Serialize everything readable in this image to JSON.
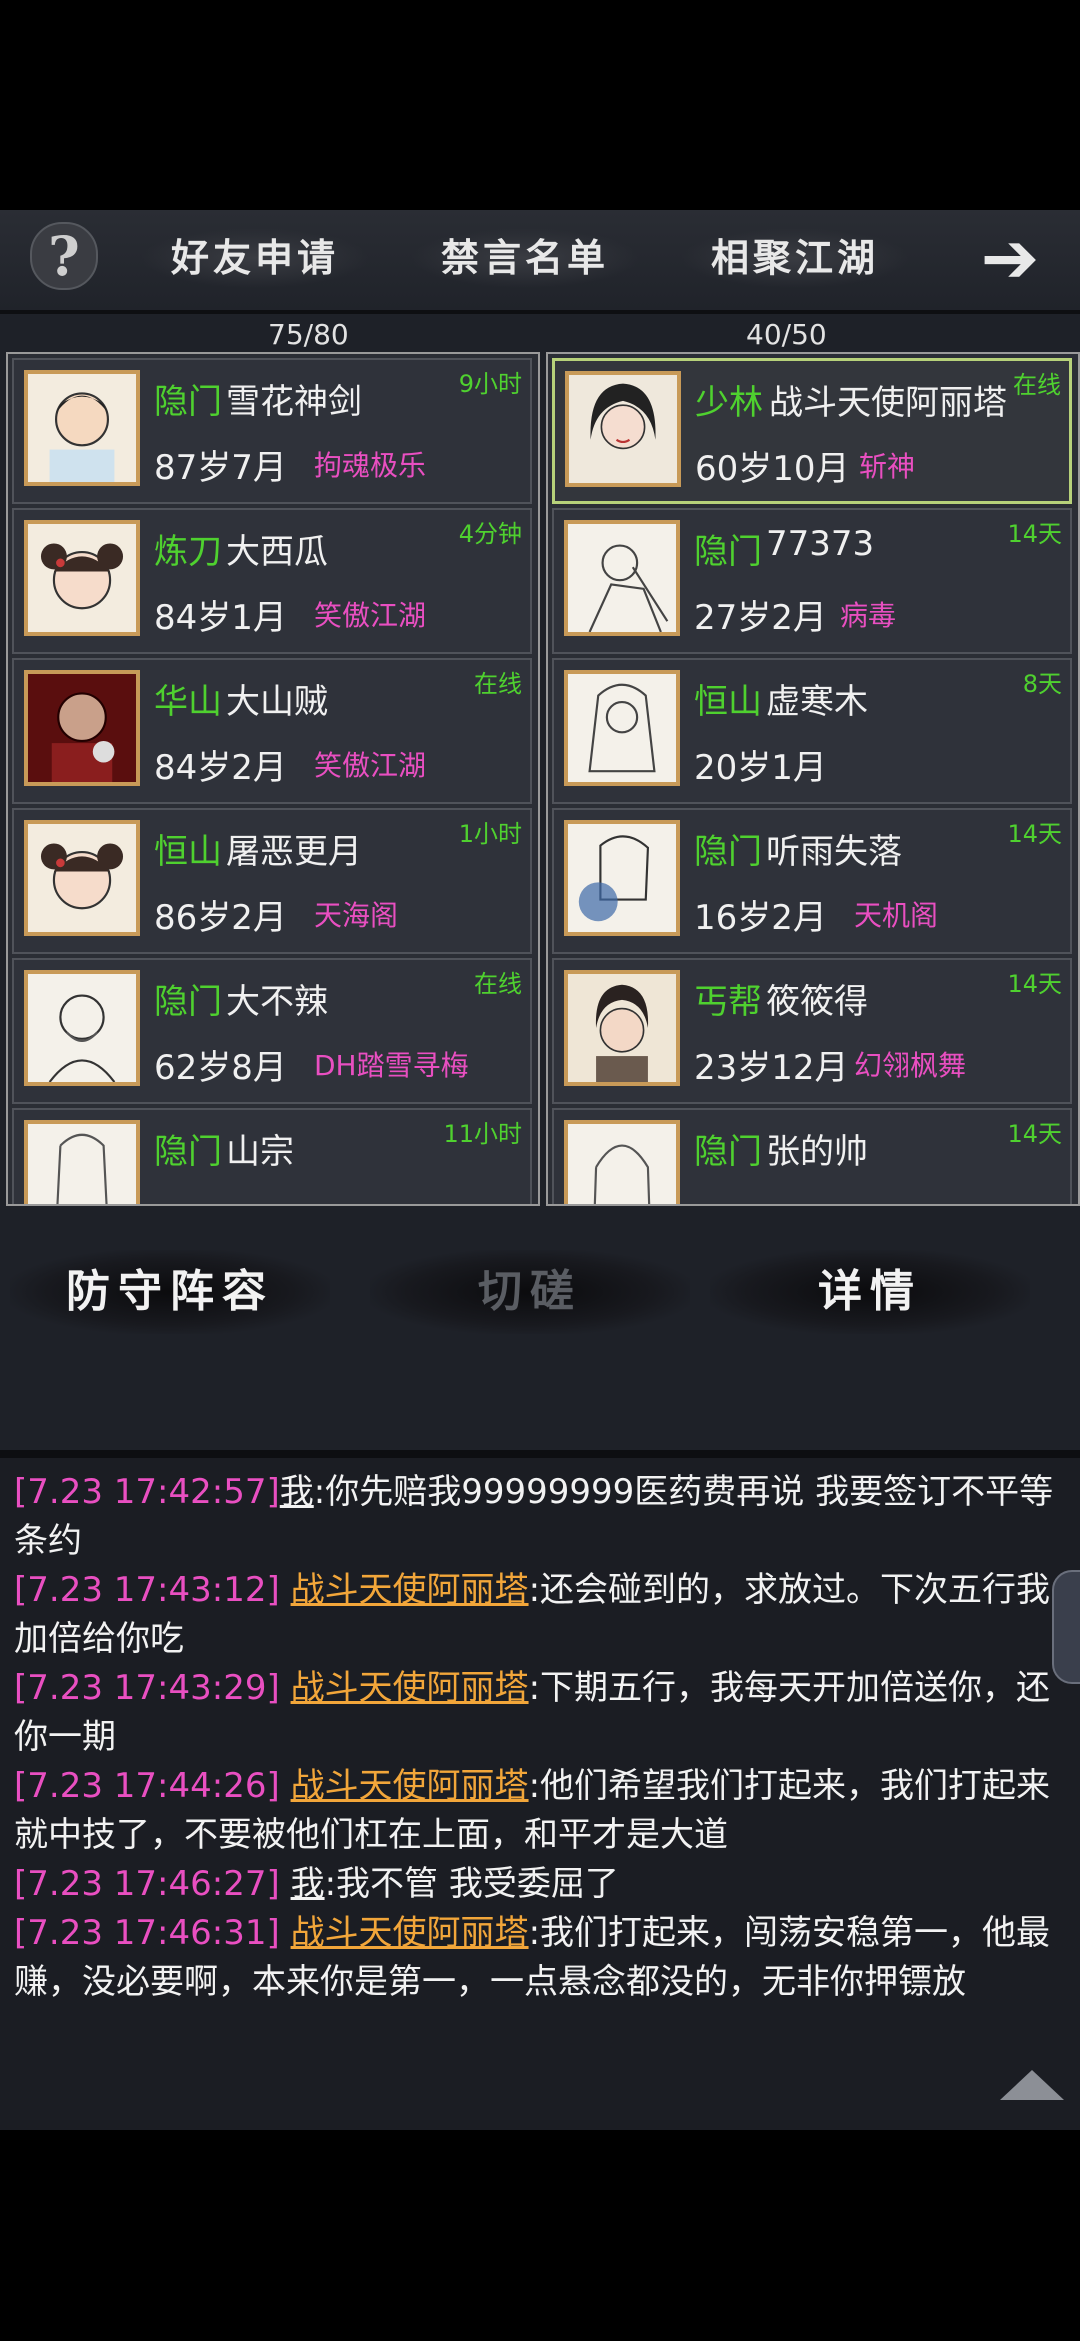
{
  "nav": {
    "help": "?",
    "tabs": [
      "好友申请",
      "禁言名单",
      "相聚江湖"
    ],
    "arrow": "➔"
  },
  "counts": {
    "left": "75/80",
    "right": "40/50"
  },
  "friends_left": [
    {
      "sect": "隐门",
      "name": "雪花神剑",
      "age": "87岁7月",
      "guild": "拘魂极乐",
      "status": "9小时"
    },
    {
      "sect": "炼刀",
      "name": "大西瓜",
      "age": "84岁1月",
      "guild": "笑傲江湖",
      "status": "4分钟"
    },
    {
      "sect": "华山",
      "name": "大山贼",
      "age": "84岁2月",
      "guild": "笑傲江湖",
      "status": "在线"
    },
    {
      "sect": "恒山",
      "name": "屠恶更月",
      "age": "86岁2月",
      "guild": "天海阁",
      "status": "1小时"
    },
    {
      "sect": "隐门",
      "name": "大不辣",
      "age": "62岁8月",
      "guild": "DH踏雪寻梅",
      "status": "在线"
    },
    {
      "sect": "隐门",
      "name": "山宗",
      "age": "",
      "guild": "",
      "status": "11小时"
    }
  ],
  "friends_right": [
    {
      "sect": "少林",
      "name": "战斗天使阿丽塔",
      "age": "60岁10月",
      "guild": "斩神",
      "status": "在线"
    },
    {
      "sect": "隐门",
      "name": "77373",
      "age": "27岁2月",
      "guild": "病毒",
      "status": "14天"
    },
    {
      "sect": "恒山",
      "name": "虚寒木",
      "age": "20岁1月",
      "guild": "",
      "status": "8天"
    },
    {
      "sect": "隐门",
      "name": "听雨失落",
      "age": "16岁2月",
      "guild": "天机阁",
      "status": "14天"
    },
    {
      "sect": "丐帮",
      "name": "筱筱得",
      "age": "23岁12月",
      "guild": "幻翎枫舞",
      "status": "14天"
    },
    {
      "sect": "隐门",
      "name": "张的帅",
      "age": "",
      "guild": "",
      "status": "14天"
    }
  ],
  "actions": {
    "defense": "防守阵容",
    "spar": "切磋",
    "details": "详情"
  },
  "chat": [
    {
      "ts": "[7.23 17:42:57]",
      "speaker": "我",
      "text": ":你先赔我99999999医药费再说 我要签订不平等条约"
    },
    {
      "ts": "[7.23 17:43:12]",
      "speaker": "战斗天使阿丽塔",
      "text": ":还会碰到的，求放过。下次五行我加倍给你吃"
    },
    {
      "ts": "[7.23 17:43:29]",
      "speaker": "战斗天使阿丽塔",
      "text": ":下期五行，我每天开加倍送你，还你一期"
    },
    {
      "ts": "[7.23 17:44:26]",
      "speaker": "战斗天使阿丽塔",
      "text": ":他们希望我们打起来，我们打起来就中技了，不要被他们杠在上面，和平才是大道"
    },
    {
      "ts": "[7.23 17:46:27]",
      "speaker": "我",
      "text": ":我不管 我受委屈了"
    },
    {
      "ts": "[7.23 17:46:31]",
      "speaker": "战斗天使阿丽塔",
      "text": ":我们打起来，闯荡安稳第一，他最赚，没必要啊，本来你是第一，一点悬念都没的，无非你押镖放"
    }
  ]
}
